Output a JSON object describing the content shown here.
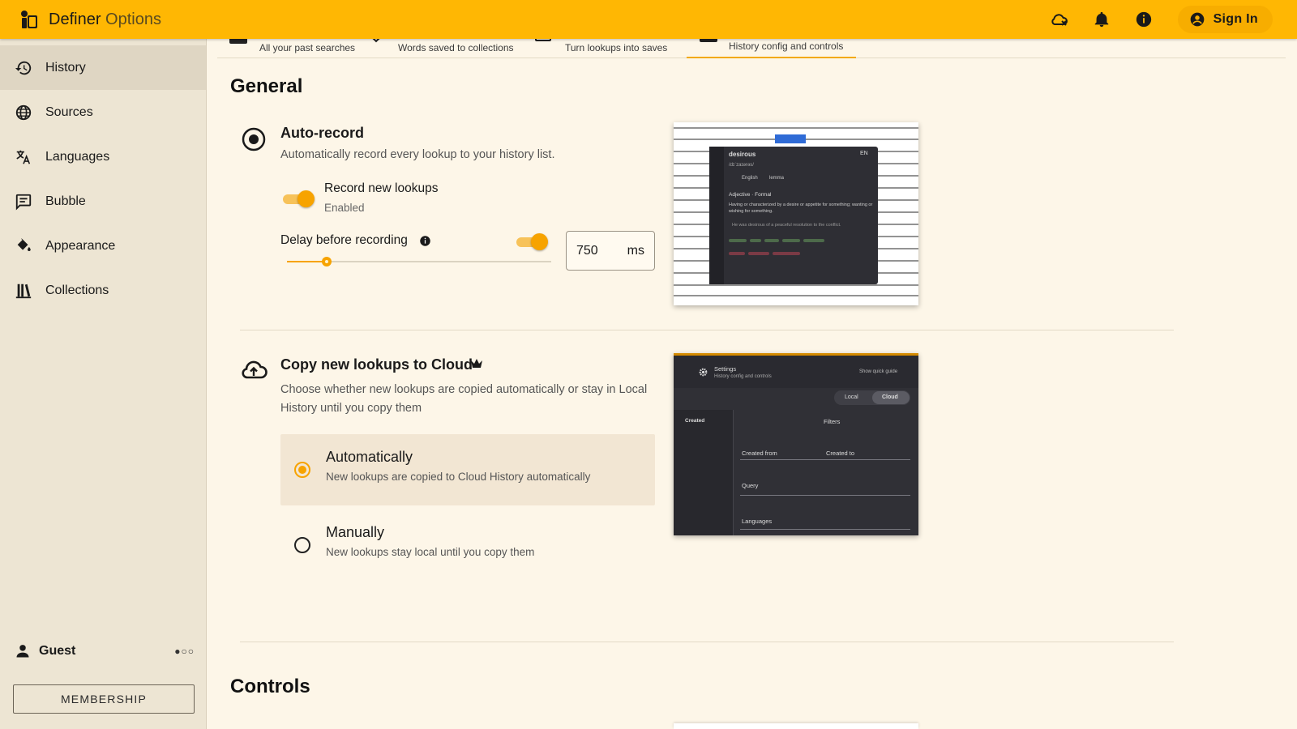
{
  "topbar": {
    "app_name": "Definer",
    "app_name_sub": "Options",
    "signin_label": "Sign In",
    "accent_color": "#ffb703"
  },
  "sidebar": {
    "items": [
      {
        "label": "History",
        "icon": "history-icon",
        "active": true
      },
      {
        "label": "Sources",
        "icon": "globe-icon"
      },
      {
        "label": "Languages",
        "icon": "translate-icon"
      },
      {
        "label": "Bubble",
        "icon": "chat-bubble-icon"
      },
      {
        "label": "Appearance",
        "icon": "paint-bucket-icon"
      },
      {
        "label": "Collections",
        "icon": "library-icon"
      }
    ],
    "user": "Guest",
    "membership_label": "MEMBERSHIP"
  },
  "tabs": [
    {
      "label": "All your past searches"
    },
    {
      "label": "Words saved to collections"
    },
    {
      "label": "Turn lookups into saves"
    },
    {
      "label": "History config and controls",
      "active": true
    }
  ],
  "general": {
    "heading": "General",
    "auto_record": {
      "title": "Auto-record",
      "description": "Automatically record every lookup to your history list.",
      "record_label": "Record new lookups",
      "record_status": "Enabled",
      "delay_label": "Delay before recording",
      "delay_value": "750",
      "delay_unit": "ms",
      "delay_fraction": 0.15
    },
    "copy_cloud": {
      "title": "Copy new lookups to Cloud",
      "description": "Choose whether new lookups are copied automatically or stay in Local History until you copy them",
      "options": [
        {
          "label": "Automatically",
          "sub": "New lookups are copied to Cloud History automatically",
          "selected": true
        },
        {
          "label": "Manually",
          "sub": "New lookups stay local until you copy them",
          "selected": false
        }
      ]
    }
  },
  "preview_popup": {
    "word": "desirous",
    "phonetic": "/dɪˈzaɪərəs/",
    "tag_lang": "English",
    "tag_type": "lemma",
    "pos": "Adjective · Formal",
    "definition": "Having or characterized by a desire or appetite for something; wanting or wishing for something.",
    "example": "He was desirous of a peaceful resolution to the conflict.",
    "lang_code": "EN"
  },
  "preview_settings": {
    "title": "Settings",
    "subtitle": "History config and controls",
    "quick_guide": "Show quick guide",
    "seg_local": "Local",
    "seg_cloud": "Cloud",
    "created_label": "Created",
    "filters": "Filters",
    "created_from": "Created from",
    "created_to": "Created to",
    "query": "Query",
    "languages": "Languages"
  },
  "controls": {
    "heading": "Controls"
  }
}
